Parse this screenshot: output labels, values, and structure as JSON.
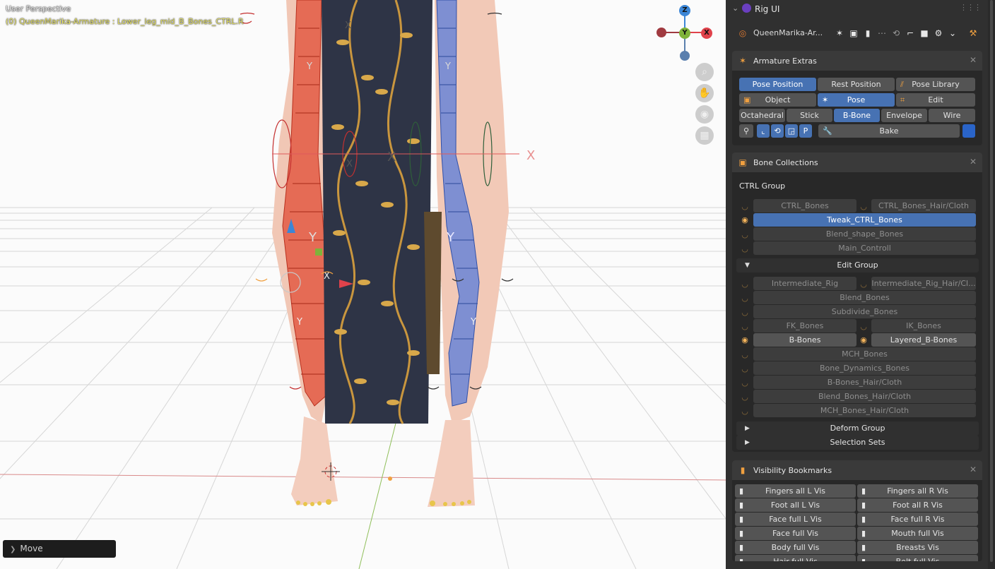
{
  "viewport": {
    "perspective_label": "User Perspective",
    "object_label": "(0) QueenMarika-Armature : Lower_leg_mid_B_Bones_CTRL.R",
    "gizmo": {
      "z": "Z",
      "x": "X",
      "y": "Y"
    },
    "nav_icons": [
      "zoom-icon",
      "hand-icon",
      "camera-icon",
      "grid-icon"
    ],
    "operator_panel": {
      "label": "Move"
    }
  },
  "sidebar": {
    "header": {
      "title": "Rig UI"
    },
    "object_name": "QueenMarika-Ar...",
    "armature_extras": {
      "title": "Armature Extras",
      "position_buttons": [
        "Pose Position",
        "Rest Position",
        "Pose Library"
      ],
      "mode_buttons": [
        "Object",
        "Pose",
        "Edit"
      ],
      "display_buttons": [
        "Octahedral",
        "Stick",
        "B-Bone",
        "Envelope",
        "Wire"
      ],
      "bake_label": "Bake"
    },
    "bone_collections": {
      "title": "Bone Collections",
      "ctrl_group_label": "CTRL Group",
      "ctrl_row1": [
        "CTRL_Bones",
        "CTRL_Bones_Hair/Cloth"
      ],
      "ctrl_items": [
        "Tweak_CTRL_Bones",
        "Blend_shape_Bones",
        "Main_Controll"
      ],
      "edit_group_label": "Edit Group",
      "edit_row1": [
        "Intermediate_Rig",
        "Intermediate_Rig_Hair/Cl..."
      ],
      "edit_items_a": [
        "Blend_Bones",
        "Subdivide_Bones"
      ],
      "edit_row2": [
        "FK_Bones",
        "IK_Bones"
      ],
      "edit_row3": [
        "B-Bones",
        "Layered_B-Bones"
      ],
      "edit_items_b": [
        "MCH_Bones",
        "Bone_Dynamics_Bones",
        "B-Bones_Hair/Cloth",
        "Blend_Bones_Hair/Cloth",
        "MCH_Bones_Hair/Cloth"
      ],
      "deform_group_label": "Deform Group",
      "selection_sets_label": "Selection Sets"
    },
    "visibility_bookmarks": {
      "title": "Visibility Bookmarks",
      "rows": [
        [
          "Fingers all L Vis",
          "Fingers all R Vis"
        ],
        [
          "Foot all L Vis",
          "Foot all R Vis"
        ],
        [
          "Face full L Vis",
          "Face full R Vis"
        ],
        [
          "Face full Vis",
          "Mouth full Vis"
        ],
        [
          "Body full Vis",
          "Breasts Vis"
        ],
        [
          "Hair full Vis",
          "Belt full Vis"
        ]
      ]
    }
  },
  "colors": {
    "accent": "#4772b3",
    "object_label": "#e8e46a",
    "axis_x": "#e0424b",
    "axis_y": "#7fb33a",
    "axis_z": "#3c86d6"
  }
}
